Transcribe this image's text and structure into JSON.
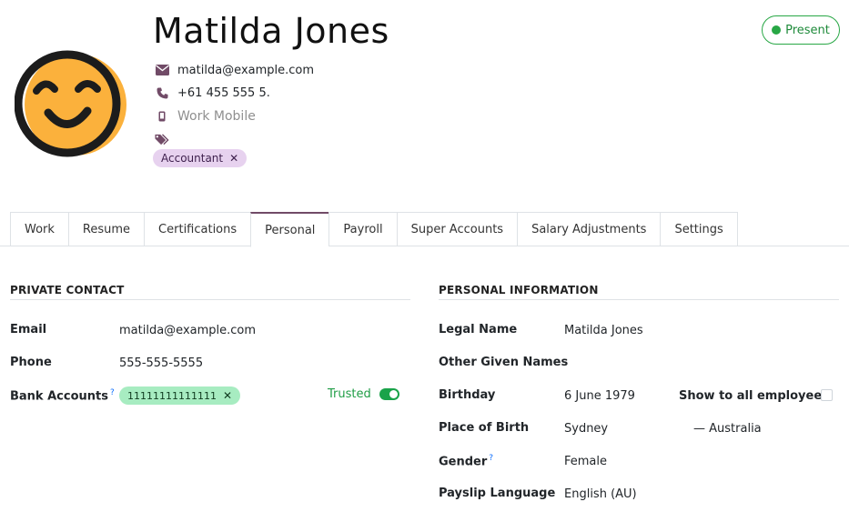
{
  "employee": {
    "name": "Matilda  Jones",
    "email": "matilda@example.com",
    "phone": "+61 455 555 5.",
    "mobile_placeholder": "Work Mobile",
    "tag": "Accountant"
  },
  "status": {
    "label": "Present",
    "color": "#28a745"
  },
  "tabs": [
    {
      "label": "Work"
    },
    {
      "label": "Resume"
    },
    {
      "label": "Certifications"
    },
    {
      "label": "Personal",
      "active": true
    },
    {
      "label": "Payroll"
    },
    {
      "label": "Super Accounts"
    },
    {
      "label": "Salary Adjustments"
    },
    {
      "label": "Settings"
    }
  ],
  "private_contact": {
    "title": "PRIVATE CONTACT",
    "email_label": "Email",
    "email_value": "matilda@example.com",
    "phone_label": "Phone",
    "phone_value": "555-555-5555",
    "bank_label": "Bank Accounts",
    "bank_help": "?",
    "bank_value": "11111111111111",
    "trusted_label": "Trusted",
    "trusted_on": true
  },
  "personal_info": {
    "title": "PERSONAL INFORMATION",
    "legal_name_label": "Legal Name",
    "legal_name_value": "Matilda Jones",
    "other_names_label": "Other Given Names",
    "birthday_label": "Birthday",
    "birthday_value": "6 June 1979",
    "show_all_label": "Show to all employees",
    "show_all_checked": false,
    "birthplace_label": "Place of Birth",
    "birthplace_city": "Sydney",
    "birthplace_country": "Australia",
    "birthplace_separator": "—",
    "gender_label": "Gender",
    "gender_help": "?",
    "gender_value": "Female",
    "payslip_lang_label": "Payslip Language",
    "payslip_lang_value": "English (AU)"
  },
  "colors": {
    "accent": "#714b67",
    "success": "#28a745",
    "tag_bg": "#e7d2ef",
    "bank_chip_bg": "#a7ecc1"
  },
  "icons": {
    "email": "envelope-icon",
    "phone": "phone-icon",
    "mobile": "mobile-icon",
    "tags": "tags-icon",
    "avatar": "smiling-face-avatar"
  }
}
